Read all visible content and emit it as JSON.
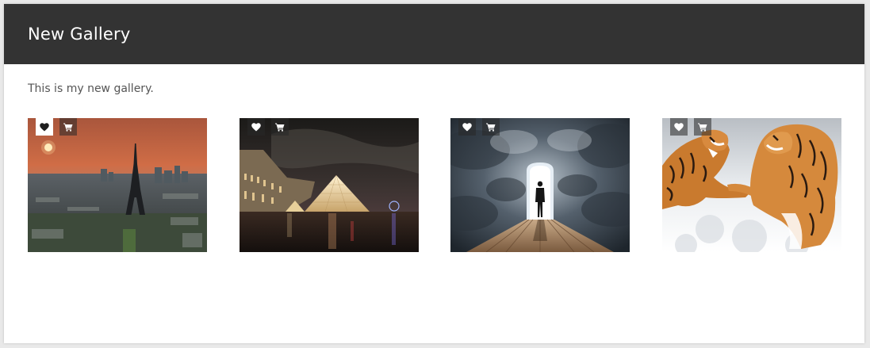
{
  "gallery": {
    "title": "New Gallery",
    "description": "This is my new gallery."
  },
  "photos": [
    {
      "subject": "paris-eiffel-tower-sunset",
      "liked": true
    },
    {
      "subject": "louvre-pyramid-night",
      "liked": false
    },
    {
      "subject": "man-walking-into-doorway-in-clouds",
      "liked": false
    },
    {
      "subject": "tigers-fighting-in-snow",
      "liked": false
    }
  ],
  "icons": {
    "like": "heart-icon",
    "cart": "cart-icon"
  },
  "colors": {
    "header_bg": "#333333",
    "title": "#ffffff",
    "text": "#555555"
  }
}
